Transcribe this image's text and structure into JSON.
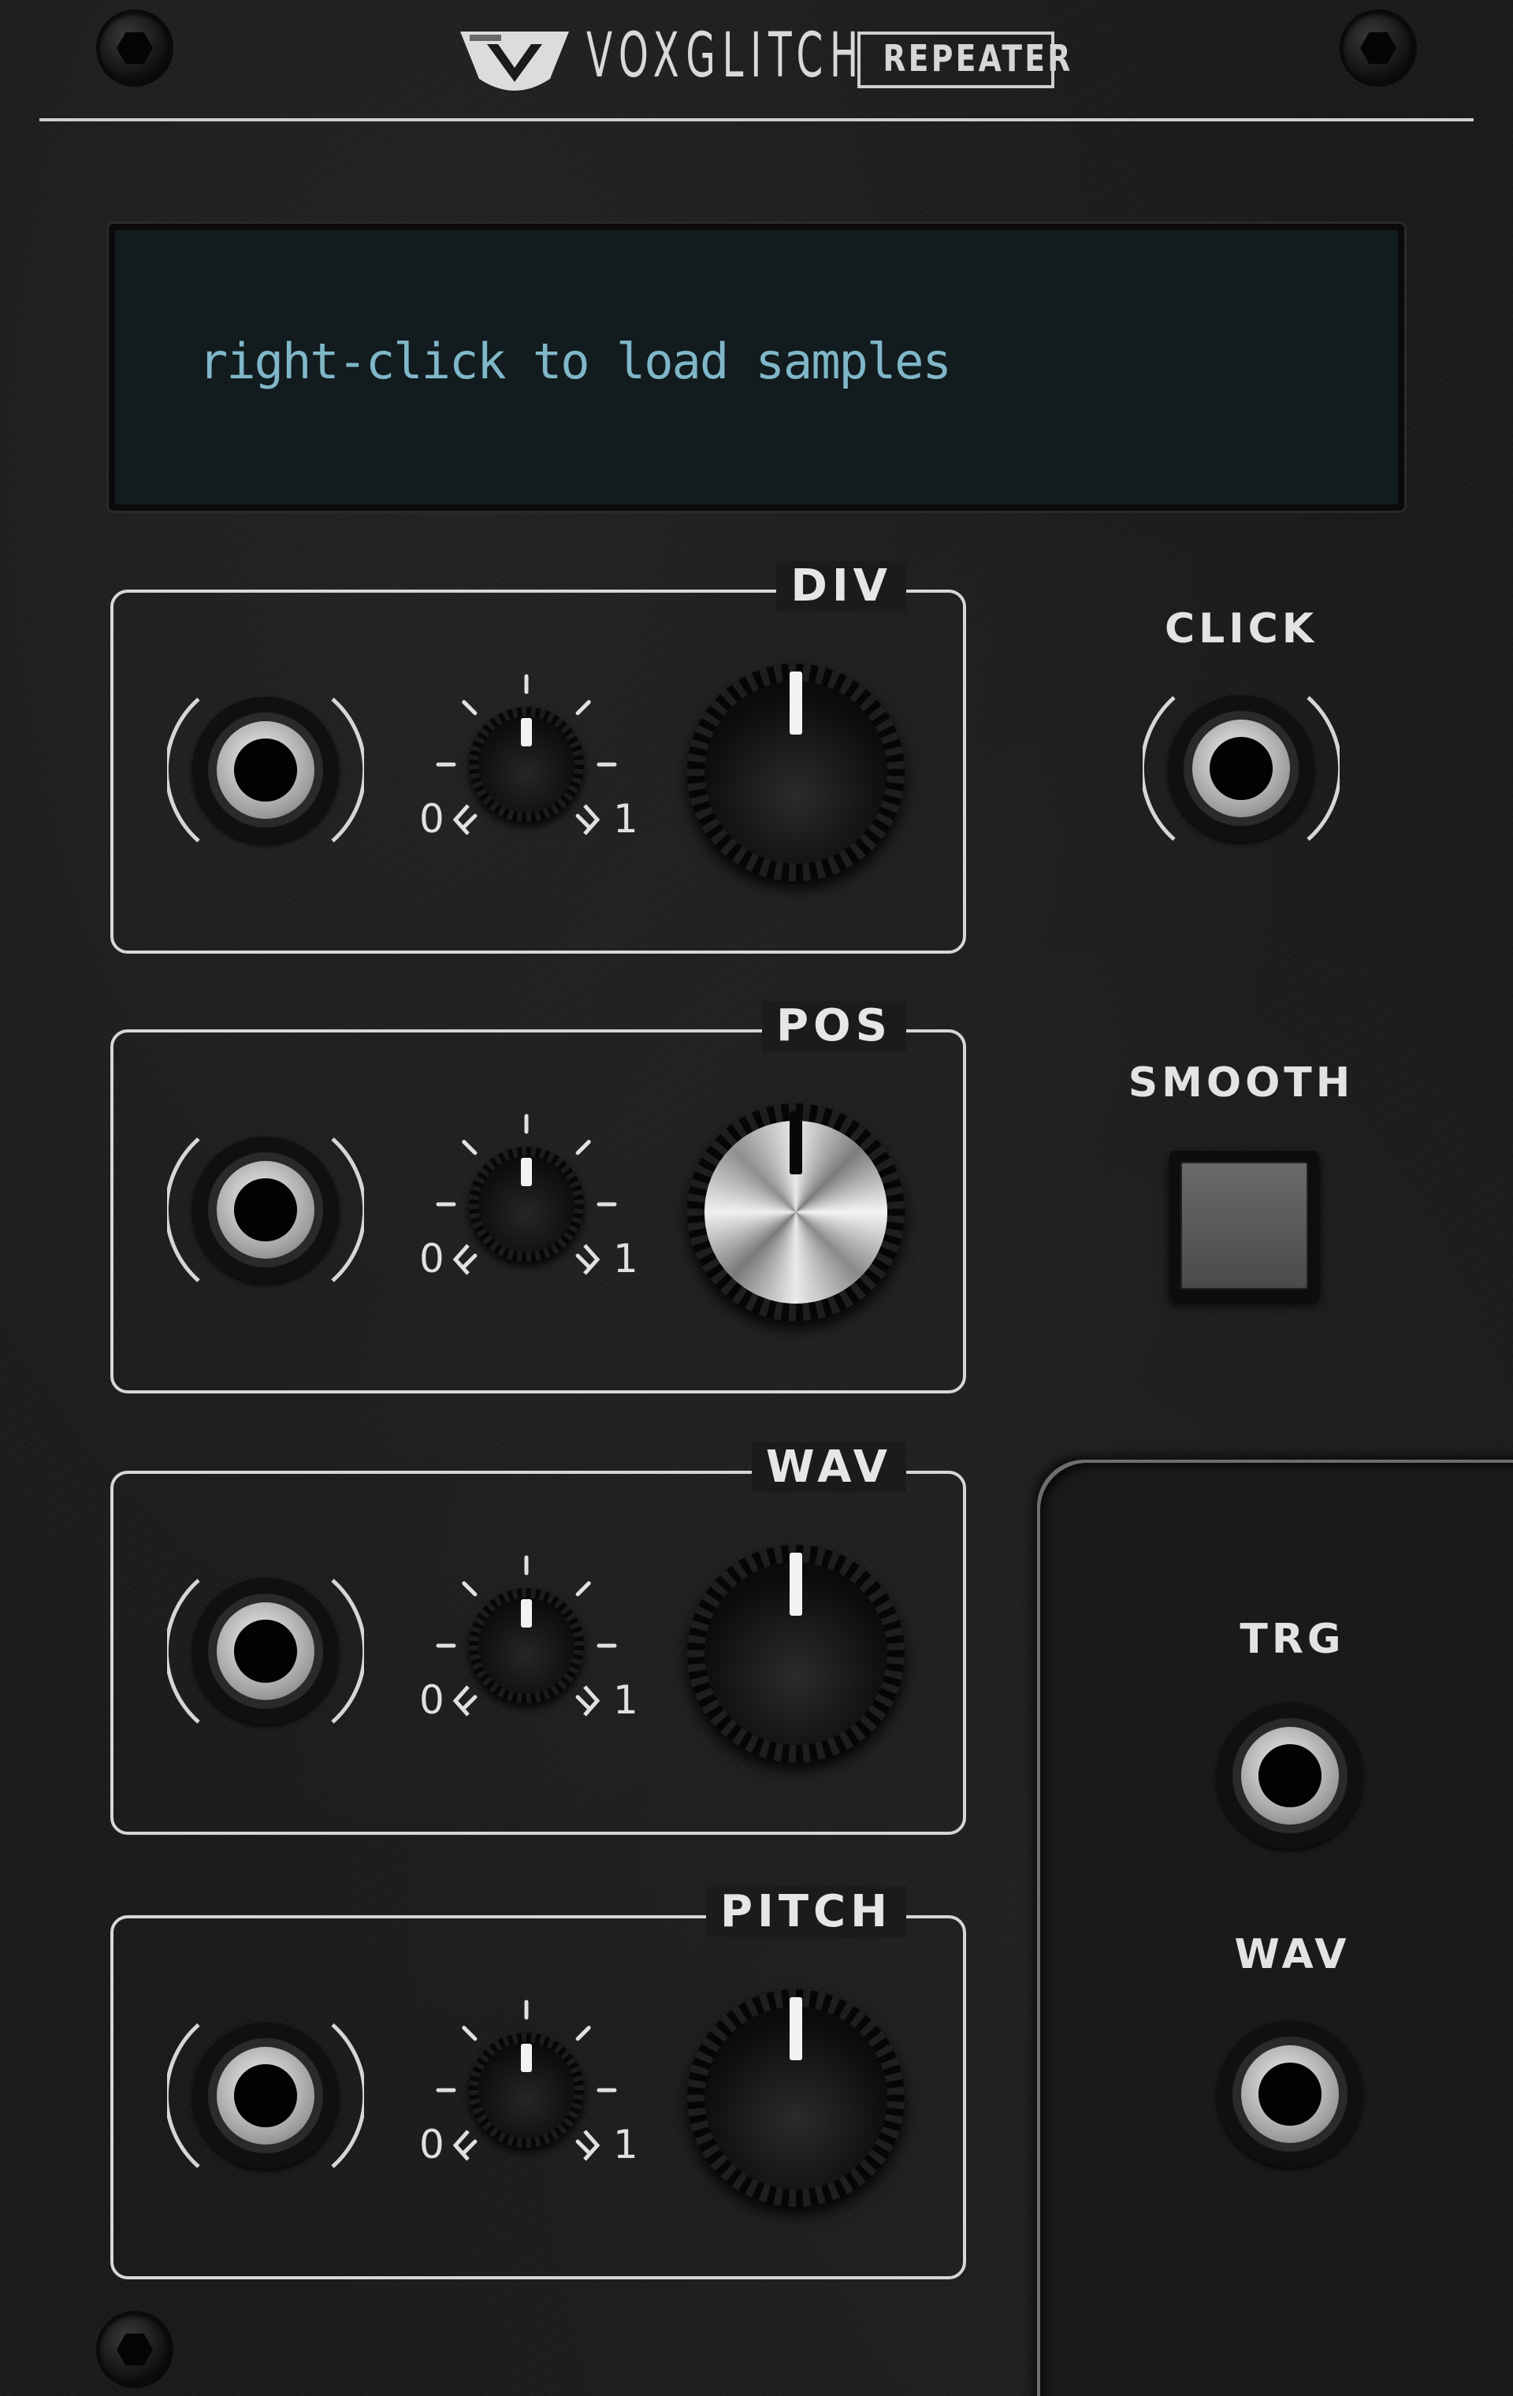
{
  "header": {
    "brand": "VOXGLITCH",
    "model": "REPEATER"
  },
  "display": {
    "text": "right-click to load samples",
    "text_color": "#7fb7c8",
    "background": "#121b1e"
  },
  "sections": [
    {
      "id": "div",
      "title": "DIV",
      "range_min": "0",
      "range_max": "1",
      "knob_style": "black"
    },
    {
      "id": "pos",
      "title": "POS",
      "range_min": "0",
      "range_max": "1",
      "knob_style": "silver"
    },
    {
      "id": "wav",
      "title": "WAV",
      "range_min": "0",
      "range_max": "1",
      "knob_style": "black"
    },
    {
      "id": "pitch",
      "title": "PITCH",
      "range_min": "0",
      "range_max": "1",
      "knob_style": "black"
    }
  ],
  "right_column": {
    "click_label": "CLICK",
    "smooth_label": "SMOOTH"
  },
  "outputs": {
    "trg_label": "TRG",
    "wav_label": "WAV"
  },
  "icons": [
    "voxglitch-logo-icon",
    "screw-icon"
  ],
  "colors": {
    "panel": "#1b1b1b",
    "line": "#d6d6d6",
    "text": "#e3e3e3"
  }
}
